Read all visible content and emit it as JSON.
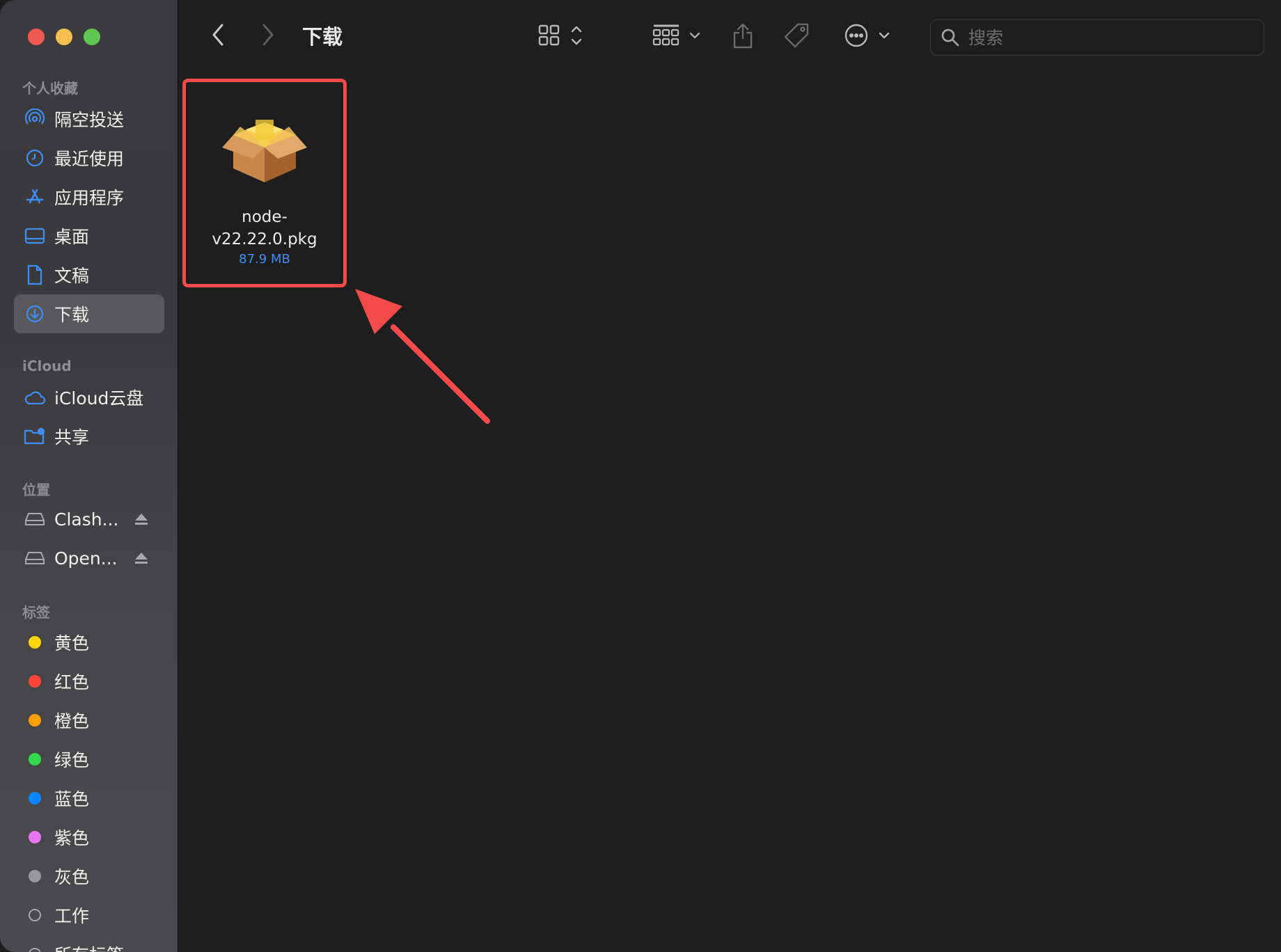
{
  "window": {
    "title": "下载"
  },
  "toolbar": {
    "title": "下载",
    "search_placeholder": "搜索",
    "back_icon": "chevron-left-icon",
    "forward_icon": "chevron-right-icon"
  },
  "sidebar": {
    "favorites_title": "个人收藏",
    "favorites": [
      {
        "label": "隔空投送",
        "icon": "airdrop-icon"
      },
      {
        "label": "最近使用",
        "icon": "clock-icon"
      },
      {
        "label": "应用程序",
        "icon": "applications-icon"
      },
      {
        "label": "桌面",
        "icon": "desktop-icon"
      },
      {
        "label": "文稿",
        "icon": "document-icon"
      },
      {
        "label": "下载",
        "icon": "download-icon",
        "selected": true
      }
    ],
    "icloud_title": "iCloud",
    "icloud": [
      {
        "label": "iCloud云盘",
        "icon": "cloud-icon"
      },
      {
        "label": "共享",
        "icon": "shared-folder-icon"
      }
    ],
    "locations_title": "位置",
    "locations": [
      {
        "label": "Clash...",
        "icon": "drive-icon"
      },
      {
        "label": "Open...",
        "icon": "drive-icon"
      }
    ],
    "tags_title": "标签",
    "tags": [
      {
        "label": "黄色",
        "color": "#ffd60a"
      },
      {
        "label": "红色",
        "color": "#ff453a"
      },
      {
        "label": "橙色",
        "color": "#ff9f0a"
      },
      {
        "label": "绿色",
        "color": "#32d74b"
      },
      {
        "label": "蓝色",
        "color": "#0a84ff"
      },
      {
        "label": "紫色",
        "color": "#e776f3"
      },
      {
        "label": "灰色",
        "color": "#98989d"
      },
      {
        "label": "工作",
        "color": ""
      },
      {
        "label": "所有标签",
        "color": ""
      }
    ]
  },
  "files": [
    {
      "name_line1": "node-",
      "name_line2": "v22.22.0.pkg",
      "size": "87.9 MB",
      "icon": "package-icon"
    }
  ],
  "colors": {
    "highlight_border": "#f34a4a",
    "accent": "#3d8ff6"
  }
}
